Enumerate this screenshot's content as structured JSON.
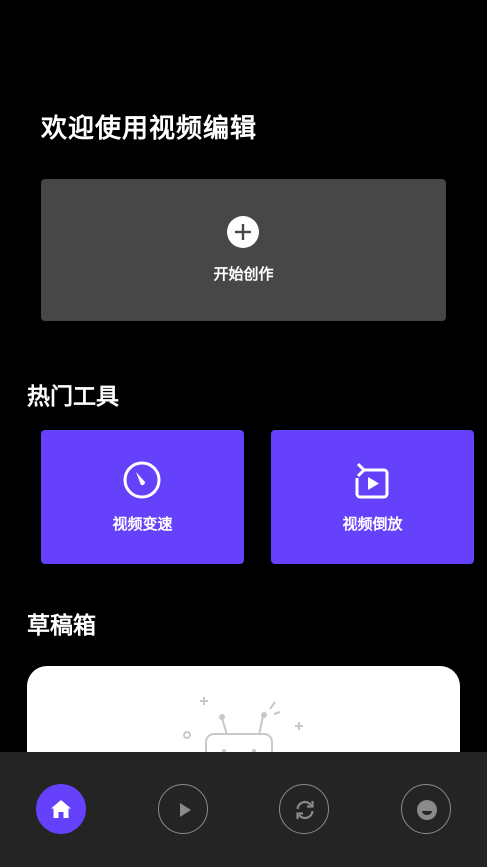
{
  "header": {
    "welcome_title": "欢迎使用视频编辑"
  },
  "create_card": {
    "label": "开始创作",
    "icon": "plus-circle-icon"
  },
  "hot_tools": {
    "title": "热门工具",
    "items": [
      {
        "label": "视频变速",
        "icon": "speedometer-icon"
      },
      {
        "label": "视频倒放",
        "icon": "reverse-play-icon"
      }
    ]
  },
  "drafts": {
    "title": "草稿箱",
    "empty_icon": "tv-empty-icon"
  },
  "bottom_nav": {
    "items": [
      {
        "icon": "home-icon",
        "active": true
      },
      {
        "icon": "play-icon",
        "active": false
      },
      {
        "icon": "refresh-icon",
        "active": false
      },
      {
        "icon": "smiley-icon",
        "active": false
      }
    ]
  },
  "colors": {
    "accent": "#6541FB",
    "card": "#474747",
    "nav": "#242424",
    "background": "#000000"
  }
}
